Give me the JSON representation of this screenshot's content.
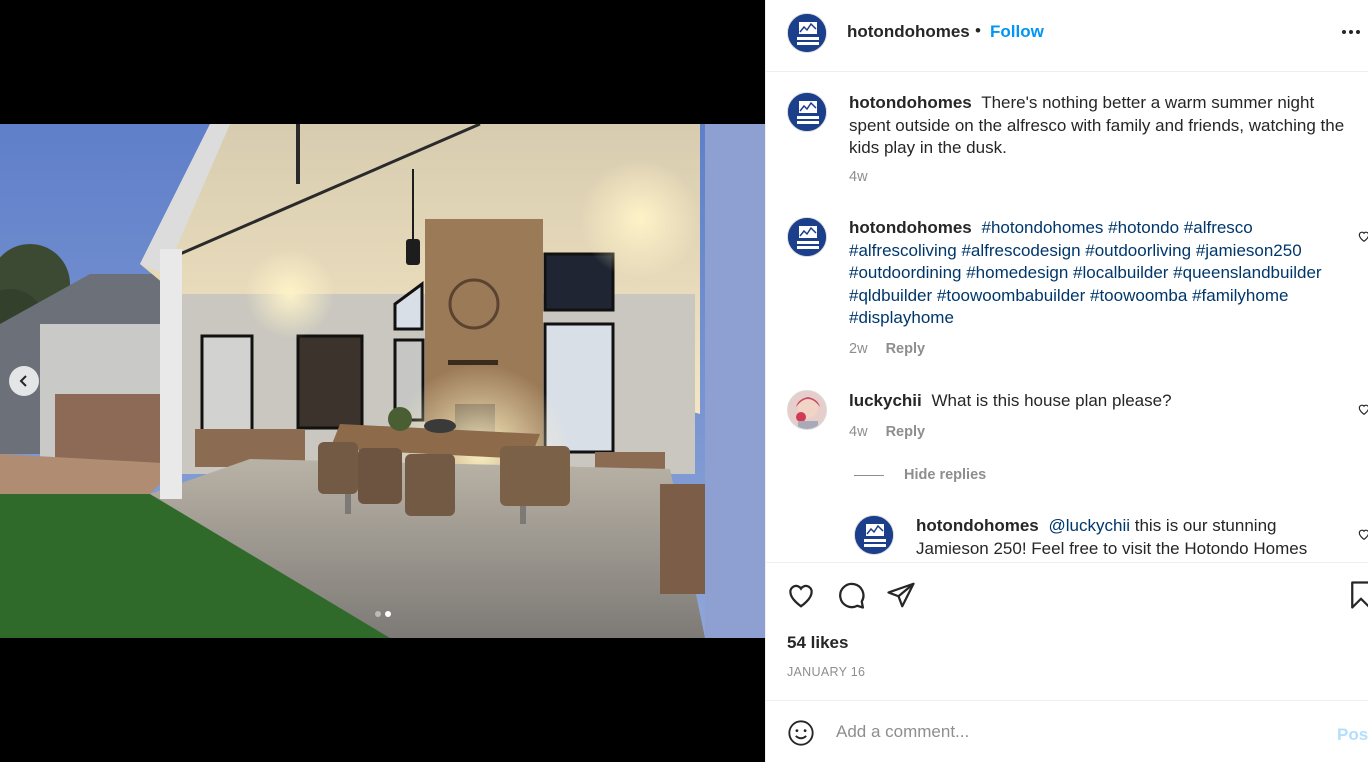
{
  "post": {
    "author": "hotondohomes",
    "separator": "•",
    "follow_label": "Follow",
    "more_icon": "more-options-icon",
    "logo_text": "Hotondo Homes"
  },
  "carousel": {
    "prev_icon": "chevron-left-icon",
    "dots": 2,
    "active_index": 1
  },
  "comments": [
    {
      "username": "hotondohomes",
      "text": "There's nothing better a warm summer night spent outside on the alfresco with family and friends, watching the kids play in the dusk.",
      "time": "4w"
    },
    {
      "username": "hotondohomes",
      "text": "#hotondohomes #hotondo #alfresco #alfrescoliving #alfrescodesign #outdoorliving #jamieson250 #outdoordining #homedesign #localbuilder #queenslandbuilder #qldbuilder #toowoombabuilder #toowoomba #familyhome #displayhome",
      "time": "2w",
      "reply_label": "Reply"
    },
    {
      "username": "luckychii",
      "text": "What is this house plan please?",
      "time": "4w",
      "reply_label": "Reply"
    }
  ],
  "hide_replies_label": "Hide replies",
  "reply": {
    "username": "hotondohomes",
    "mention": "@luckychii",
    "text": "this is our stunning Jamieson 250! Feel free to visit the Hotondo Homes"
  },
  "actions": {
    "like_icon": "heart-icon",
    "comment_icon": "comment-icon",
    "share_icon": "share-icon",
    "save_icon": "bookmark-icon"
  },
  "likes": "54 likes",
  "date": "JANUARY 16",
  "add_comment": {
    "emoji_icon": "emoji-icon",
    "placeholder": "Add a comment...",
    "post_label": "Post"
  },
  "colors": {
    "accent": "#0095f6",
    "hashtag": "#00376b",
    "muted": "#8e8e8e",
    "post_disabled": "#b2dffc",
    "brand": "#1c3f8c"
  }
}
